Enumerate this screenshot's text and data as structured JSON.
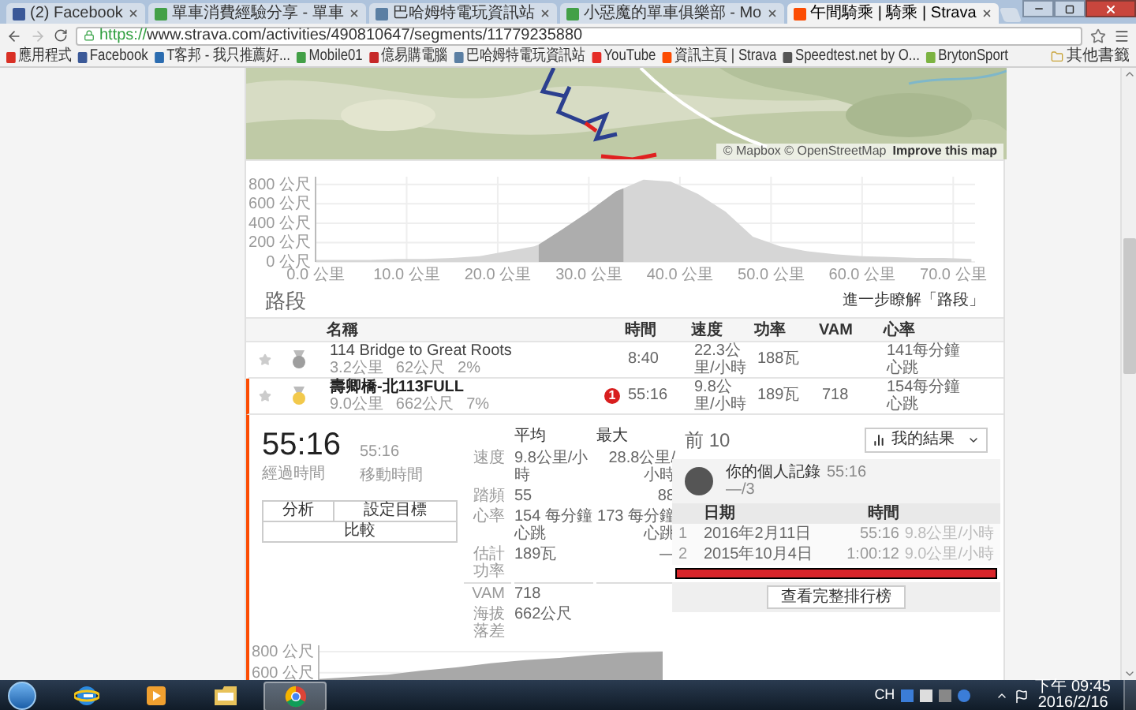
{
  "browser": {
    "tabs": [
      {
        "title": "(2) Facebook",
        "color": "#3b5998",
        "selected": false
      },
      {
        "title": "單車消費經驗分享 - 單車",
        "color": "#43a047",
        "selected": false
      },
      {
        "title": "巴哈姆特電玩資訊站",
        "color": "#5b7fa3",
        "selected": false
      },
      {
        "title": "小惡魔的單車俱樂部 - Mo",
        "color": "#43a047",
        "selected": false
      },
      {
        "title": "午間騎乘 | 騎乘 | Strava",
        "color": "#fc4c02",
        "selected": true
      }
    ],
    "url_scheme": "https://",
    "url_rest": "www.strava.com/activities/490810647/segments/11779235880",
    "bookmarks": [
      {
        "label": "應用程式",
        "color": "#d93025"
      },
      {
        "label": "Facebook",
        "color": "#3b5998"
      },
      {
        "label": "T客邦 - 我只推薦好...",
        "color": "#2b6cb0"
      },
      {
        "label": "Mobile01",
        "color": "#43a047"
      },
      {
        "label": "億易購電腦",
        "color": "#c62828"
      },
      {
        "label": "巴哈姆特電玩資訊站",
        "color": "#5b7fa3"
      },
      {
        "label": "YouTube",
        "color": "#e52d27"
      },
      {
        "label": "資訊主頁 | Strava",
        "color": "#fc4c02"
      },
      {
        "label": "Speedtest.net by O...",
        "color": "#555555"
      },
      {
        "label": "BrytonSport",
        "color": "#7cb342"
      }
    ],
    "other_bookmarks": "其他書籤"
  },
  "map": {
    "attribution": "© Mapbox © OpenStreetMap",
    "improve_link": "Improve this map"
  },
  "elevation": {
    "chart_data": {
      "type": "area",
      "grid": true,
      "x": [
        0,
        3,
        6,
        9,
        12,
        15,
        18,
        21,
        24,
        24.5,
        27,
        30,
        33,
        33.8,
        36,
        39,
        42,
        45,
        48,
        51,
        54,
        57,
        60,
        63,
        66,
        69,
        72
      ],
      "series": [
        {
          "color": "#d6d6d6",
          "values": [
            20,
            20,
            20,
            30,
            30,
            40,
            60,
            110,
            160,
            180,
            330,
            520,
            730,
            760,
            850,
            830,
            700,
            520,
            260,
            160,
            110,
            80,
            60,
            50,
            40,
            40,
            30
          ]
        },
        {
          "color": "#adadad",
          "values": [
            null,
            null,
            null,
            null,
            null,
            null,
            null,
            null,
            null,
            180,
            330,
            520,
            730,
            760,
            null,
            null,
            null,
            null,
            null,
            null,
            null,
            null,
            null,
            null,
            null,
            null,
            null
          ]
        }
      ],
      "xlim": [
        0,
        72.4
      ],
      "ylim": [
        0,
        880
      ],
      "xticks": [
        {
          "value": 0,
          "label": "0.0 公里"
        },
        {
          "value": 10,
          "label": "10.0 公里"
        },
        {
          "value": 20,
          "label": "20.0 公里"
        },
        {
          "value": 30,
          "label": "30.0 公里"
        },
        {
          "value": 40,
          "label": "40.0 公里"
        },
        {
          "value": 50,
          "label": "50.0 公里"
        },
        {
          "value": 60,
          "label": "60.0 公里"
        },
        {
          "value": 70,
          "label": "70.0 公里"
        }
      ],
      "yticks": [
        {
          "value": 0,
          "label": "0 公尺"
        },
        {
          "value": 200,
          "label": "200 公尺"
        },
        {
          "value": 400,
          "label": "400 公尺"
        },
        {
          "value": 600,
          "label": "600 公尺"
        },
        {
          "value": 800,
          "label": "800 公尺"
        }
      ]
    }
  },
  "segments": {
    "title": "路段",
    "learn_more": "進一步瞭解「路段」",
    "columns": [
      "名稱",
      "時間",
      "速度",
      "功率",
      "VAM",
      "心率"
    ],
    "rows": [
      {
        "color": "#9e9e9e",
        "name": "114 Bridge to Great Roots",
        "distance": "3.2公里",
        "elevation": "62公尺",
        "grade": "2%",
        "time": "8:40",
        "speed": "22.3公里/小時",
        "power": "188瓦",
        "vam": "",
        "heart_rate": "141每分鐘心跳",
        "selected": false
      },
      {
        "color": "#f2c94c",
        "name": "壽卿橋-北113FULL",
        "distance": "9.0公里",
        "elevation": "662公尺",
        "grade": "7%",
        "rank": "1",
        "time": "55:16",
        "speed": "9.8公里/小時",
        "power": "189瓦",
        "vam": "718",
        "heart_rate": "154每分鐘心跳",
        "selected": true
      }
    ]
  },
  "effort": {
    "elapsed_time": "55:16",
    "elapsed_label": "經過時間",
    "moving_time": "55:16",
    "moving_label": "移動時間",
    "buttons": [
      "分析",
      "設定目標",
      "比較"
    ],
    "stats_header": [
      "平均",
      "最大"
    ],
    "stats": [
      {
        "label": "速度",
        "avg": "9.8公里/小時",
        "max": "28.8公里/小時"
      },
      {
        "label": "踏頻",
        "avg": "55",
        "max": "88"
      },
      {
        "label": "心率",
        "avg": "154 每分鐘心跳",
        "max": "173 每分鐘心跳"
      },
      {
        "label": "估計功率",
        "avg": "189瓦",
        "max": "—"
      },
      {
        "label": "VAM",
        "avg": "718",
        "divider": true
      },
      {
        "label": "海拔落差",
        "avg": "662公尺"
      }
    ],
    "chart_data": {
      "type": "area",
      "grid": true,
      "series": [
        {
          "color": "#a8a8a8",
          "values": [
            540,
            560,
            580,
            620,
            650,
            690,
            720,
            740,
            770,
            790,
            800
          ]
        }
      ],
      "ylim": [
        500,
        860
      ],
      "yticks": [
        {
          "value": 600,
          "label": "600 公尺"
        },
        {
          "value": 800,
          "label": "800 公尺"
        }
      ]
    }
  },
  "leaderboard": {
    "title": "前 10",
    "filter": "我的結果",
    "record_label": "你的個人記錄",
    "record_time": "55:16",
    "record_rank": "—/3",
    "columns": [
      "日期",
      "時間"
    ],
    "rows": [
      {
        "rank": "1",
        "date": "2016年2月11日",
        "time": "55:16",
        "speed": "9.8公里/小時"
      },
      {
        "rank": "2",
        "date": "2015年10月4日",
        "time": "1:00:12",
        "speed": "9.0公里/小時"
      }
    ],
    "full_button": "查看完整排行榜"
  },
  "taskbar": {
    "apps": [
      {
        "kind": "ie",
        "selected": false
      },
      {
        "kind": "media",
        "selected": false
      },
      {
        "kind": "explorer",
        "selected": false
      },
      {
        "kind": "chrome",
        "selected": true
      }
    ],
    "language": "CH",
    "time": "下午 09:45",
    "date": "2016/2/16"
  }
}
